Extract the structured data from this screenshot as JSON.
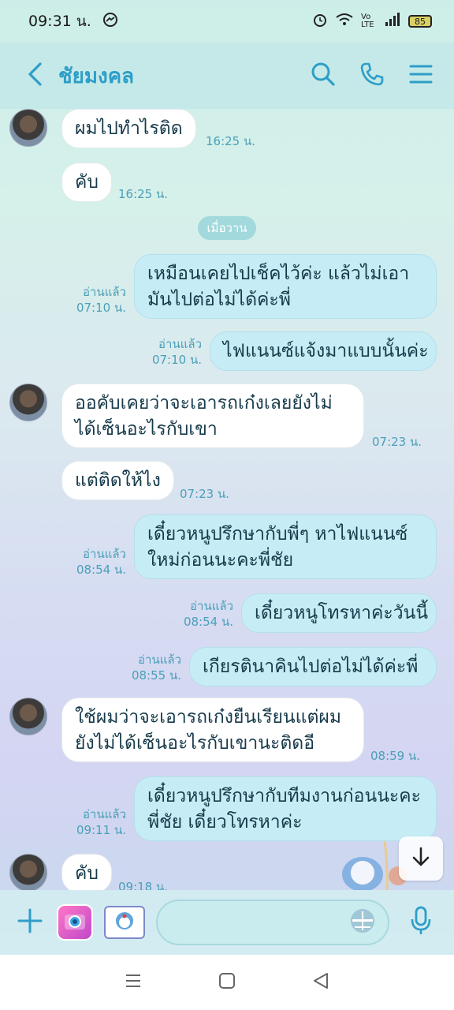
{
  "status_bar": {
    "time": "09:31 น.",
    "battery": "85",
    "network": "Vo LTE"
  },
  "header": {
    "contact_name": "ชัยมงคล"
  },
  "chat": {
    "date_separator": "เมื่อวาน",
    "read_label": "อ่านแล้ว",
    "messages": [
      {
        "direction": "in",
        "lines": [
          "ผมไปทำไรติด"
        ],
        "time": "16:25 น."
      },
      {
        "direction": "in",
        "lines": [
          "คับ"
        ],
        "time": "16:25 น."
      },
      {
        "direction": "out",
        "lines": [
          "เหมือนเคยไปเช็คไว้ค่ะ แล้วไม่เอา",
          "มันไปต่อไม่ได้ค่ะพี่"
        ],
        "time": "07:10 น."
      },
      {
        "direction": "out",
        "lines": [
          "ไฟแนนซ์แจ้งมาแบบนั้นค่ะ"
        ],
        "time": "07:10 น."
      },
      {
        "direction": "in",
        "lines": [
          "ออคับเคยว่าจะเอารถเก๋งเลยยังไม่",
          "ได้เซ็นอะไรกับเขา"
        ],
        "time": "07:23 น."
      },
      {
        "direction": "in",
        "lines": [
          "แต่ติดให้ไง"
        ],
        "time": "07:23 น."
      },
      {
        "direction": "out",
        "lines": [
          "เดี๋ยวหนูปรึกษากับพี่ๆ หาไฟแนนซ์",
          "ใหม่ก่อนนะคะพี่ชัย"
        ],
        "time": "08:54 น."
      },
      {
        "direction": "out",
        "lines": [
          "เดี๋ยวหนูโทรหาค่ะวันนี้"
        ],
        "time": "08:54 น."
      },
      {
        "direction": "out",
        "lines": [
          "เกียรตินาคินไปต่อไม่ได้ค่ะพี่"
        ],
        "time": "08:55 น."
      },
      {
        "direction": "in",
        "lines": [
          "ใช้ผมว่าจะเอารถเก๋งยืนเรียนแต่ผม",
          "ยังไม่ได้เซ็นอะไรกับเขานะติดอี"
        ],
        "time": "08:59 น."
      },
      {
        "direction": "out",
        "lines": [
          "เดี๋ยวหนูปรึกษากับทีมงานก่อนนะคะ",
          "พี่ชัย เดี๋ยวโทรหาค่ะ"
        ],
        "time": "09:11 น."
      },
      {
        "direction": "in",
        "lines": [
          "คับ"
        ],
        "time": "09:18 น."
      }
    ]
  },
  "input": {
    "placeholder": ""
  },
  "icons": {
    "back": "chevron-left-icon",
    "search": "search-icon",
    "call": "phone-icon",
    "menu": "hamburger-menu-icon",
    "plus": "plus-icon",
    "camera": "camera-icon",
    "image": "image-icon",
    "emoji": "emoji-icon",
    "mic": "microphone-icon",
    "scroll": "arrow-down-icon"
  },
  "colors": {
    "accent": "#2e9ec8",
    "bubble_out": "#c6ecf5",
    "bubble_in": "#ffffff",
    "time_text": "#4a9fb8"
  }
}
